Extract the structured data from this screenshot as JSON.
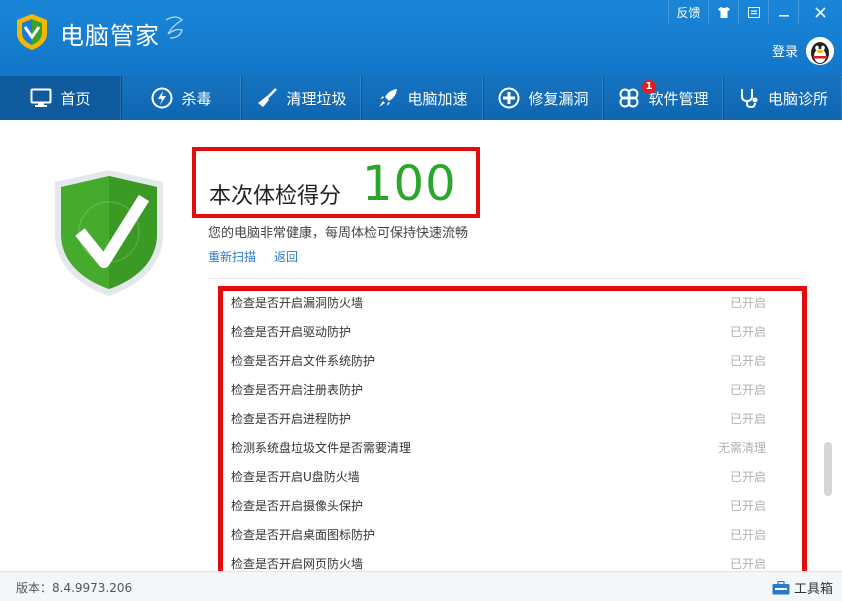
{
  "titlebar": {
    "app_name": "电脑管家",
    "feedback": "反馈",
    "login": "登录",
    "icons": [
      "shirt-icon",
      "settings-menu-icon",
      "minimize-icon",
      "close-icon"
    ]
  },
  "nav": {
    "items": [
      {
        "label": "首页",
        "icon": "monitor-icon"
      },
      {
        "label": "杀毒",
        "icon": "lightning-icon"
      },
      {
        "label": "清理垃圾",
        "icon": "broom-icon"
      },
      {
        "label": "电脑加速",
        "icon": "rocket-icon"
      },
      {
        "label": "修复漏洞",
        "icon": "shield-patch-icon"
      },
      {
        "label": "软件管理",
        "icon": "software-icon",
        "badge": "1"
      },
      {
        "label": "电脑诊所",
        "icon": "stethoscope-icon"
      }
    ]
  },
  "result": {
    "score_label": "本次体检得分",
    "score": "100",
    "message": "您的电脑非常健康，每周体检可保持快速流畅",
    "rescan": "重新扫描",
    "back": "返回"
  },
  "checks": [
    {
      "label": "检查是否开启漏洞防火墙",
      "status": "已开启"
    },
    {
      "label": "检查是否开启驱动防护",
      "status": "已开启"
    },
    {
      "label": "检查是否开启文件系统防护",
      "status": "已开启"
    },
    {
      "label": "检查是否开启注册表防护",
      "status": "已开启"
    },
    {
      "label": "检查是否开启进程防护",
      "status": "已开启"
    },
    {
      "label": "检测系统盘垃圾文件是否需要清理",
      "status": "无需清理"
    },
    {
      "label": "检查是否开启U盘防火墙",
      "status": "已开启"
    },
    {
      "label": "检查是否开启摄像头保护",
      "status": "已开启"
    },
    {
      "label": "检查是否开启桌面图标防护",
      "status": "已开启"
    },
    {
      "label": "检查是否开启网页防火墙",
      "status": "已开启"
    }
  ],
  "footer": {
    "version": "版本：8.4.9973.206",
    "toolbox": "工具箱"
  },
  "colors": {
    "titlebar": "#1a86d8",
    "nav": "#1673c0",
    "score_green": "#2ca52c",
    "highlight_red": "#e20c0c",
    "link": "#2a7ad0"
  }
}
